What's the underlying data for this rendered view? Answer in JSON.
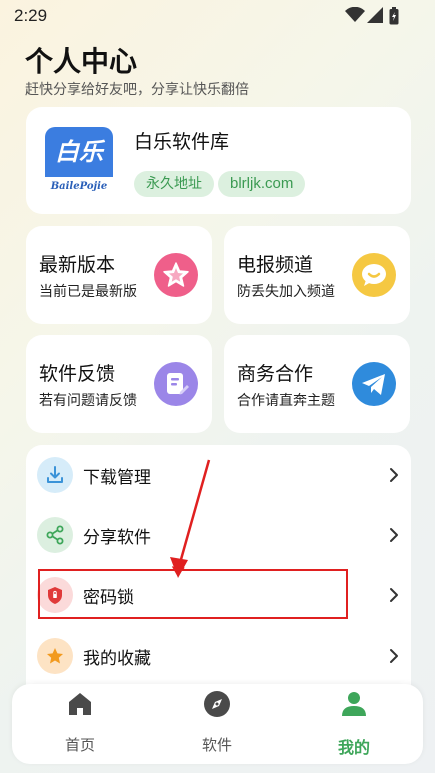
{
  "status_bar": {
    "time": "2:29"
  },
  "header": {
    "title": "个人中心",
    "subtitle": "赶快分享给好友吧，分享让快乐翻倍"
  },
  "app_card": {
    "logo_text": "白乐",
    "logo_caption": "BailePojie",
    "name": "白乐软件库",
    "tags": [
      "永久地址",
      "blrljk.com"
    ]
  },
  "tiles": [
    {
      "title": "最新版本",
      "subtitle": "当前已是最新版",
      "icon": "star-icon"
    },
    {
      "title": "电报频道",
      "subtitle": "防丢失加入频道",
      "icon": "chat-bubble-icon"
    },
    {
      "title": "软件反馈",
      "subtitle": "若有问题请反馈",
      "icon": "edit-note-icon"
    },
    {
      "title": "商务合作",
      "subtitle": "合作请直奔主题",
      "icon": "telegram-icon"
    }
  ],
  "menu": {
    "items": [
      {
        "label": "下载管理",
        "icon": "download-icon"
      },
      {
        "label": "分享软件",
        "icon": "share-icon"
      },
      {
        "label": "密码锁",
        "icon": "shield-lock-icon"
      },
      {
        "label": "我的收藏",
        "icon": "star-icon"
      }
    ]
  },
  "bottom_nav": {
    "items": [
      {
        "label": "首页",
        "icon": "home-icon",
        "active": false
      },
      {
        "label": "软件",
        "icon": "compass-icon",
        "active": false
      },
      {
        "label": "我的",
        "icon": "user-icon",
        "active": true
      }
    ]
  },
  "colors": {
    "accent_green": "#3ea65a",
    "highlight_red": "#e02020",
    "logo_blue": "#3b7de0"
  }
}
